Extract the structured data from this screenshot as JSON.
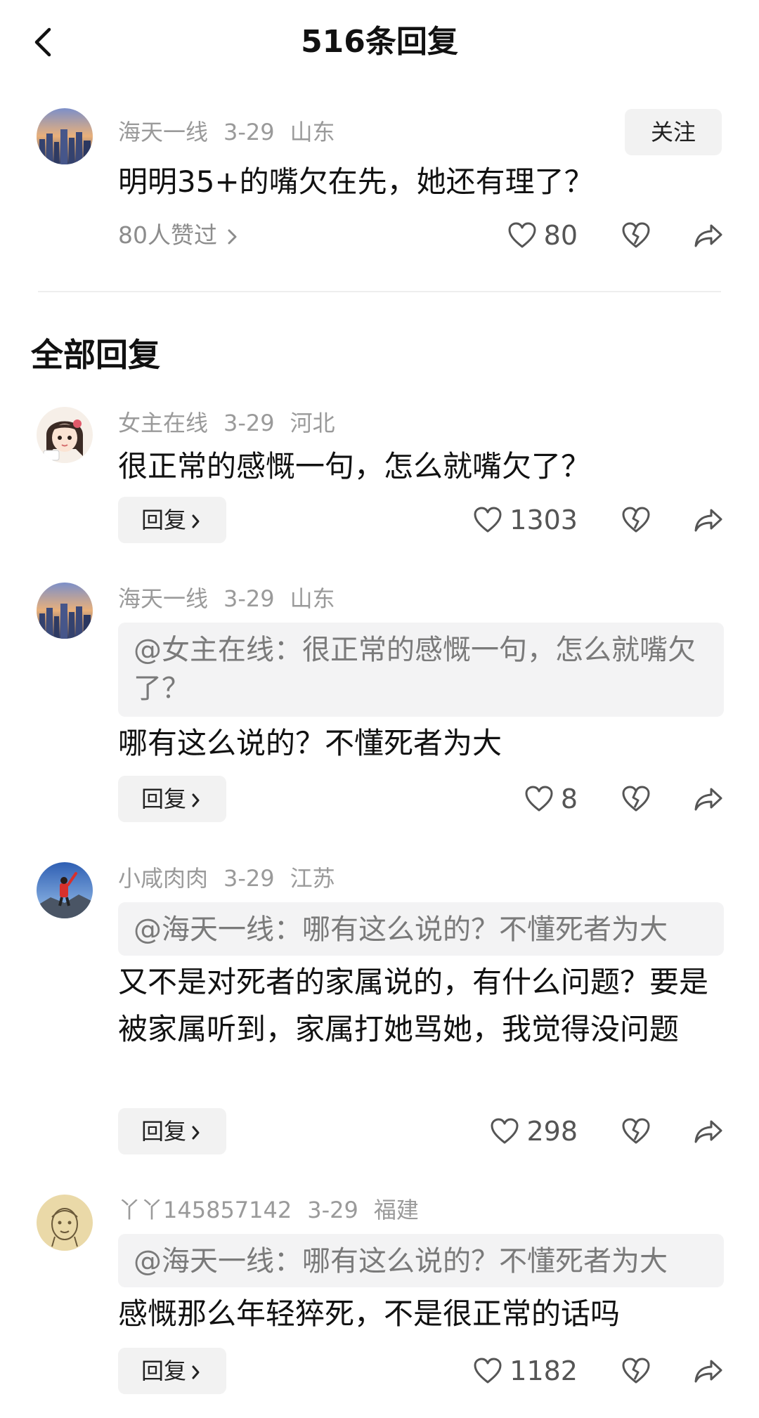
{
  "header": {
    "title": "516条回复"
  },
  "main_comment": {
    "username": "海天一线",
    "date": "3-29",
    "location": "山东",
    "follow_label": "关注",
    "text": "明明35+的嘴欠在先，她还有理了？",
    "likers_text": "80人赞过",
    "likes": "80"
  },
  "section_title": "全部回复",
  "replies": [
    {
      "username": "女主在线",
      "date": "3-29",
      "location": "河北",
      "quote": "",
      "text": "很正常的感慨一句，怎么就嘴欠了？",
      "reply_label": "回复",
      "likes": "1303"
    },
    {
      "username": "海天一线",
      "date": "3-29",
      "location": "山东",
      "quote": "@女主在线：很正常的感慨一句，怎么就嘴欠了？",
      "text": "哪有这么说的？不懂死者为大",
      "reply_label": "回复",
      "likes": "8"
    },
    {
      "username": "小咸肉肉",
      "date": "3-29",
      "location": "江苏",
      "quote": "@海天一线：哪有这么说的？不懂死者为大",
      "text": "又不是对死者的家属说的，有什么问题？要是被家属听到，家属打她骂她，我觉得没问题",
      "reply_label": "回复",
      "likes": "298"
    },
    {
      "username": "丫丫145857142",
      "date": "3-29",
      "location": "福建",
      "quote": "@海天一线：哪有这么说的？不懂死者为大",
      "text": "感慨那么年轻猝死，不是很正常的话吗",
      "reply_label": "回复",
      "likes": "1182"
    }
  ],
  "icons": {
    "back": "chevron-left-icon",
    "like": "heart-outline-icon",
    "dislike": "broken-heart-icon",
    "share": "share-arrow-icon",
    "more": "chevron-right-icon"
  },
  "colors": {
    "meta_text": "#9a9a9a",
    "button_bg": "#f2f2f2",
    "quote_bg": "#f3f3f4",
    "quote_text": "#7a7a7a"
  }
}
